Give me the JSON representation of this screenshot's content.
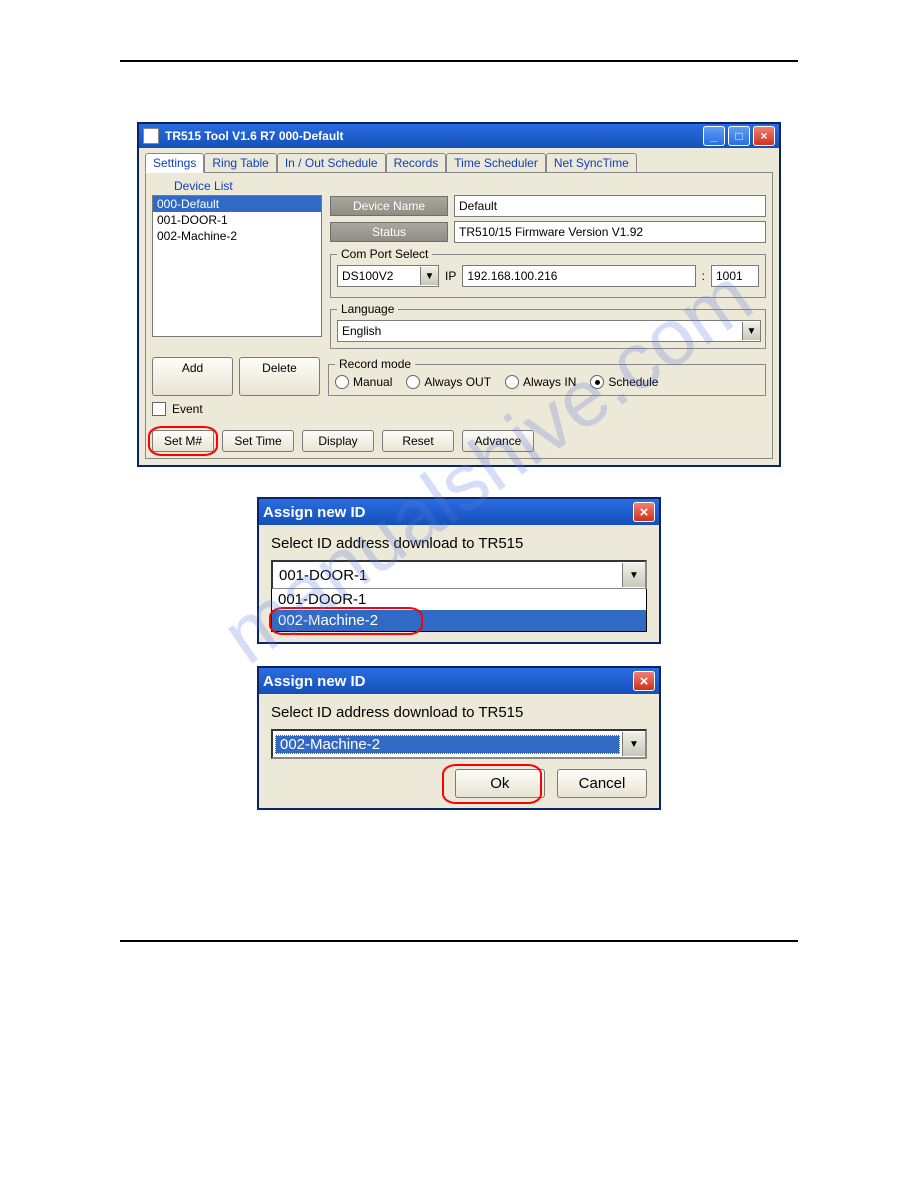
{
  "watermark_text": "manualshive.com",
  "main_window": {
    "title": "TR515 Tool V1.6 R7   000-Default",
    "tabs": [
      "Settings",
      "Ring Table",
      "In / Out Schedule",
      "Records",
      "Time Scheduler",
      "Net SyncTime"
    ],
    "active_tab_index": 0,
    "device_list_label": "Device List",
    "devices": [
      "000-Default",
      "001-DOOR-1",
      "002-Machine-2"
    ],
    "selected_device_index": 0,
    "device_name_btn": "Device Name",
    "device_name_value": "Default",
    "status_btn": "Status",
    "status_value": "TR510/15 Firmware Version V1.92",
    "comport_legend": "Com Port Select",
    "comport_value": "DS100V2",
    "ip_label": "IP",
    "ip_value": "192.168.100.216",
    "port_sep": ":",
    "port_value": "1001",
    "language_legend": "Language",
    "language_value": "English",
    "recordmode_legend": "Record mode",
    "recordmode_options": [
      "Manual",
      "Always OUT",
      "Always IN",
      "Schedule"
    ],
    "recordmode_selected_index": 3,
    "add_btn": "Add",
    "delete_btn": "Delete",
    "event_label": "Event",
    "bottom_buttons": [
      "Set M#",
      "Set Time",
      "Display",
      "Reset",
      "Advance"
    ]
  },
  "dialog1": {
    "title": "Assign new ID",
    "prompt": "Select ID address download to TR515",
    "selected_value": "001-DOOR-1",
    "options": [
      "001-DOOR-1",
      "002-Machine-2"
    ],
    "highlight_index": 1
  },
  "dialog2": {
    "title": "Assign new ID",
    "prompt": "Select ID address download to TR515",
    "selected_value": "002-Machine-2",
    "ok_btn": "Ok",
    "cancel_btn": "Cancel"
  }
}
